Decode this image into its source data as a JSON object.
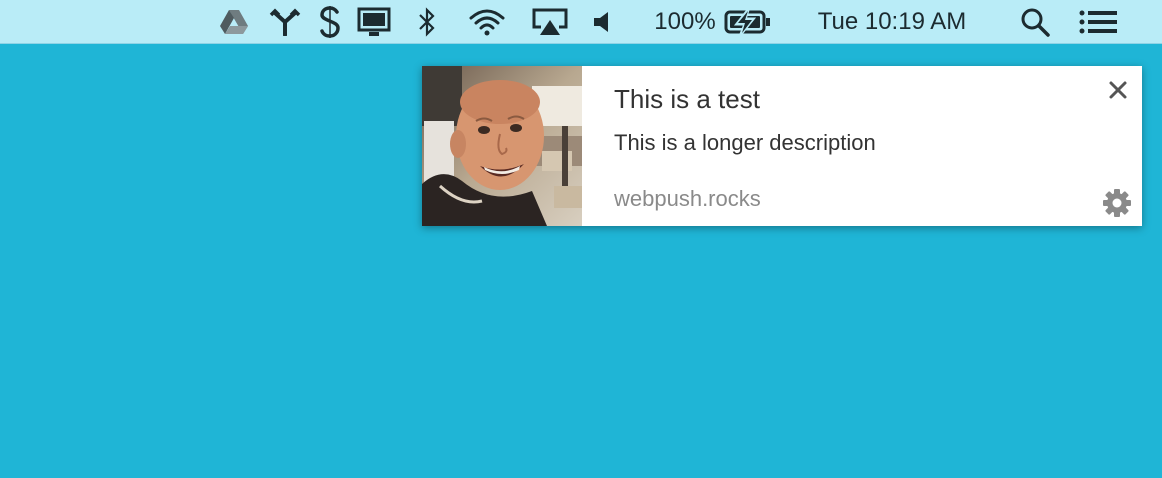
{
  "menubar": {
    "battery_percent": "100%",
    "clock": "Tue 10:19 AM",
    "icons": [
      "google-drive-icon",
      "fork-icon",
      "s-app-icon",
      "display-icon",
      "bluetooth-icon",
      "wifi-icon",
      "airplay-icon",
      "volume-icon",
      "battery-charging-icon",
      "search-icon",
      "list-icon"
    ]
  },
  "notification": {
    "title": "This is a test",
    "body": "This is a longer description",
    "origin": "webpush.rocks",
    "image": "avatar-photo",
    "close_icon": "close-icon",
    "settings_icon": "gear-icon"
  },
  "colors": {
    "desktop": "#1fb5d6",
    "menubar": "#b9ecf7",
    "notification_bg": "#ffffff",
    "title_text": "#333333",
    "origin_text": "#8a8a8a"
  }
}
